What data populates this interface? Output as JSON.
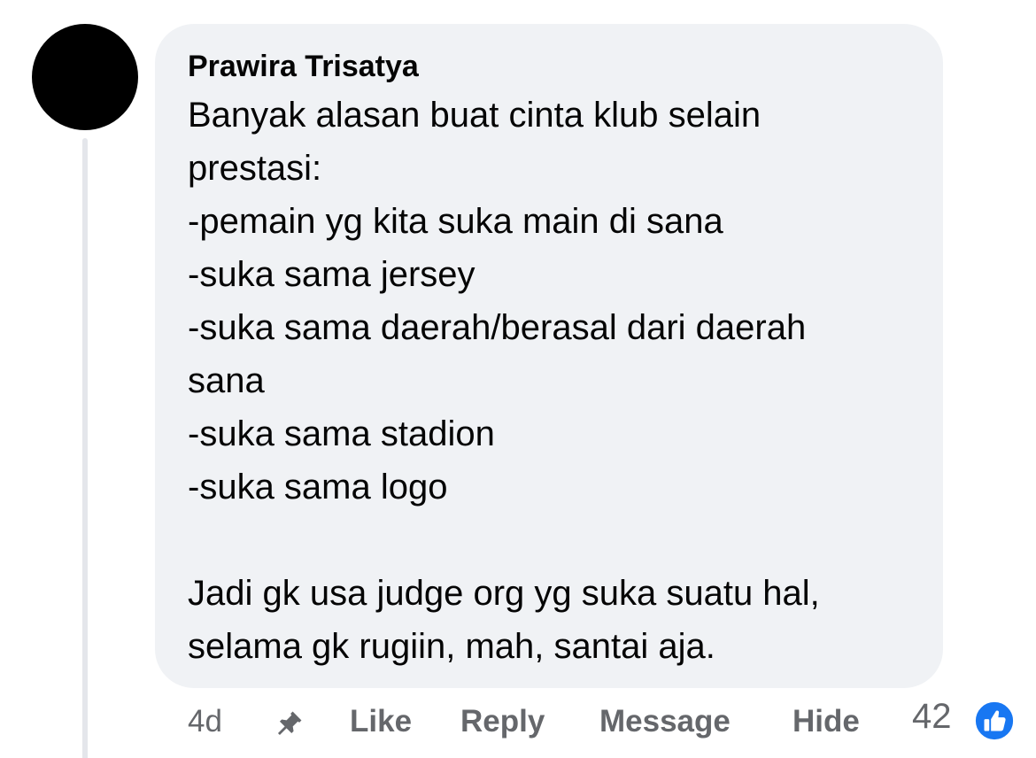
{
  "comment": {
    "author": "Prawira Trisatya",
    "lines": [
      "Banyak alasan buat cinta klub selain",
      "prestasi:",
      "-pemain yg kita suka main di sana",
      "-suka sama jersey",
      "-suka sama daerah/berasal dari daerah",
      "sana",
      "-suka sama stadion",
      "-suka sama logo",
      "",
      "Jadi gk usa judge org yg suka suatu hal,",
      "selama gk rugiin, mah, santai aja."
    ]
  },
  "actions": {
    "timestamp": "4d",
    "pin_icon": "pin-icon",
    "like_label": "Like",
    "reply_label": "Reply",
    "message_label": "Message",
    "hide_label": "Hide"
  },
  "reactions": {
    "count": "42",
    "icon": "thumbs-up-icon",
    "color": "#1877f2"
  }
}
